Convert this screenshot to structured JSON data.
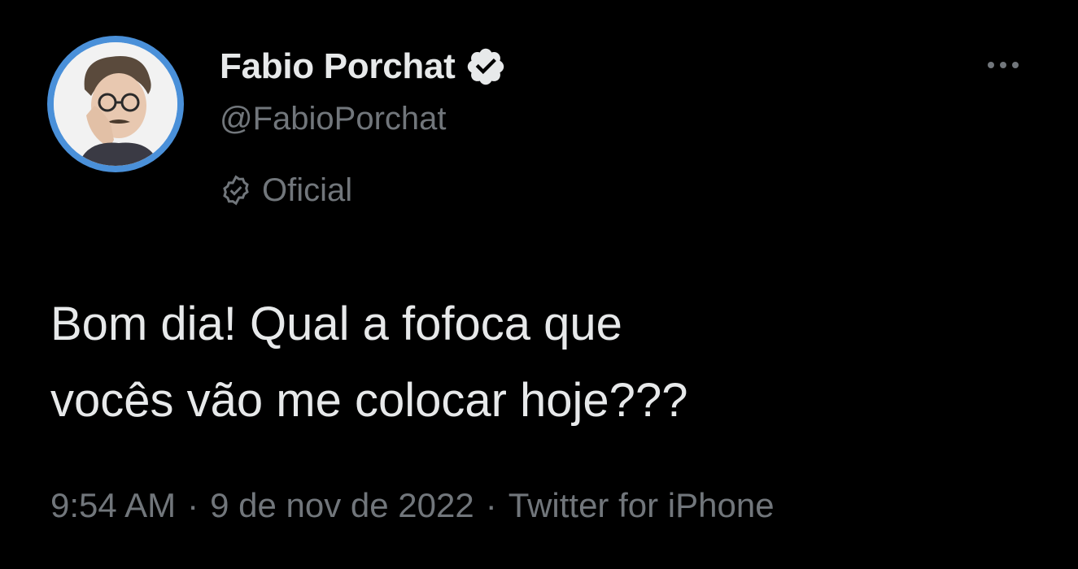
{
  "author": {
    "display_name": "Fabio Porchat",
    "handle": "@FabioPorchat",
    "label": "Oficial",
    "verified": true
  },
  "tweet": {
    "text": "Bom dia! Qual a fofoca que\nvocês vão me colocar hoje???",
    "time": "9:54 AM",
    "date": "9 de nov de 2022",
    "separator": "·",
    "source": "Twitter for iPhone"
  },
  "icons": {
    "verified": "verified-badge-icon",
    "official": "official-badge-icon",
    "more": "more-options-icon"
  },
  "colors": {
    "background": "#000000",
    "primary_text": "#e7e9ea",
    "secondary_text": "#71767b",
    "avatar_ring": "#4a90d9"
  }
}
